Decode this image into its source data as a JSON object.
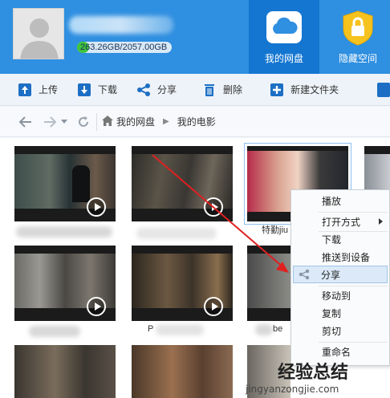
{
  "header": {
    "storage_text": "263.26GB/2057.00GB",
    "storage_used_fraction": 0.128,
    "tabs": [
      {
        "label": "我的网盘",
        "icon": "cloud-icon",
        "active": true
      },
      {
        "label": "隐藏空间",
        "icon": "lock-icon",
        "active": false
      }
    ]
  },
  "toolbar": {
    "upload": "上传",
    "download": "下载",
    "share": "分享",
    "delete": "删除",
    "new_folder": "新建文件夹"
  },
  "address": {
    "crumbs": [
      "我的网盘",
      "我的电影"
    ]
  },
  "files": {
    "partial_names": [
      "特勤jiu",
      "P",
      "be"
    ]
  },
  "context_menu": {
    "items": [
      "播放",
      "打开方式",
      "下载",
      "推送到设备",
      "分享",
      "移动到",
      "复制",
      "剪切",
      "重命名"
    ],
    "highlighted": "分享"
  },
  "watermark": {
    "cn": "经验总结",
    "url": "jingyanzongjie.com"
  },
  "colors": {
    "header_bg": "#2f8fe0",
    "active_tab_bg": "#1476d1",
    "storage_fill": "#3ec43e",
    "toolbar_icon": "#1c6fc4",
    "annotation_arrow": "#e02020"
  }
}
